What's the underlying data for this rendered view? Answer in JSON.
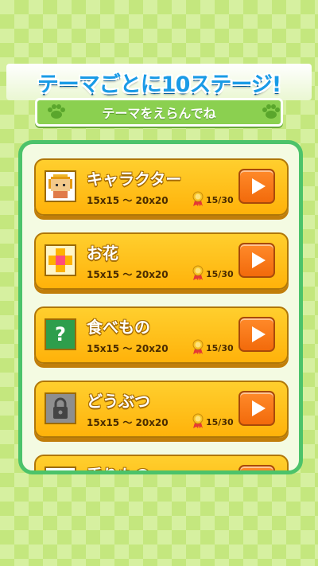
{
  "header": {
    "title": "テーマごとに10ステージ!",
    "subtitle": "テーマをえらんでね"
  },
  "themes": [
    {
      "title": "キャラクター",
      "size_range": "15x15 〜 20x20",
      "progress": "15/30",
      "thumb_icon": "character-pixel-icon"
    },
    {
      "title": "お花",
      "size_range": "15x15 〜 20x20",
      "progress": "15/30",
      "thumb_icon": "flower-pixel-icon"
    },
    {
      "title": "食べもの",
      "size_range": "15x15 〜 20x20",
      "progress": "15/30",
      "thumb_icon": "question-mark-icon"
    },
    {
      "title": "どうぶつ",
      "size_range": "15x15 〜 20x20",
      "progress": "15/30",
      "thumb_icon": "lock-icon"
    },
    {
      "title": "乗りもの",
      "size_range": "",
      "progress": "",
      "thumb_icon": ""
    }
  ],
  "colors": {
    "card": "#ffc21a",
    "play_button": "#f97b18",
    "frame": "#4cc36a",
    "title_blue": "#1a9be6",
    "subtitle_green": "#8bd050"
  }
}
